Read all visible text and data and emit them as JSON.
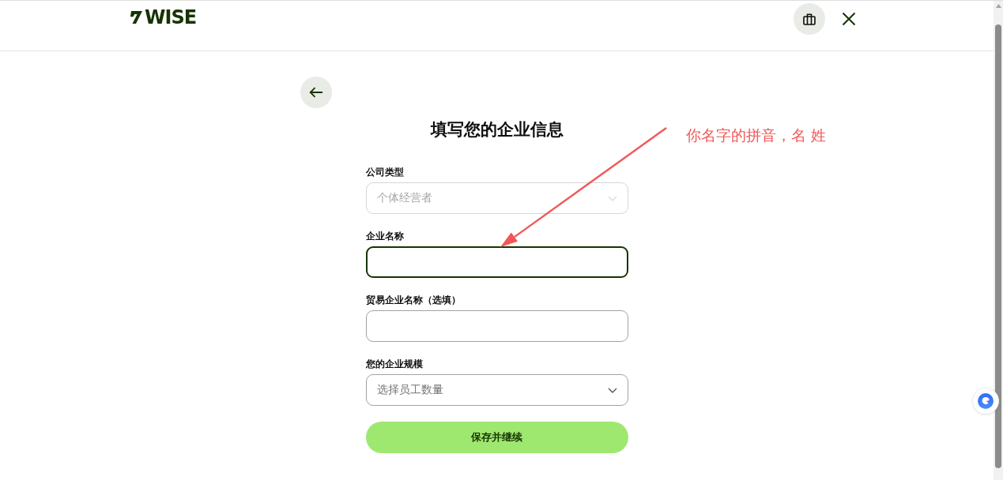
{
  "header": {
    "logo": "WISE"
  },
  "form": {
    "title": "填写您的企业信息",
    "fields": [
      {
        "kind": "select",
        "label": "公司类型",
        "value": "个体经营者",
        "disabled": true,
        "focused": false
      },
      {
        "kind": "input",
        "label": "企业名称",
        "disabled": false,
        "focused": true
      },
      {
        "kind": "input",
        "label": "贸易企业名称（选填）",
        "disabled": false,
        "focused": false
      },
      {
        "kind": "select",
        "label": "您的企业规模",
        "placeholder": "选择员工数量",
        "disabled": false,
        "focused": false
      }
    ],
    "submit": "保存并继续"
  },
  "annotation": {
    "text": "你名字的拼音，名 姓"
  }
}
